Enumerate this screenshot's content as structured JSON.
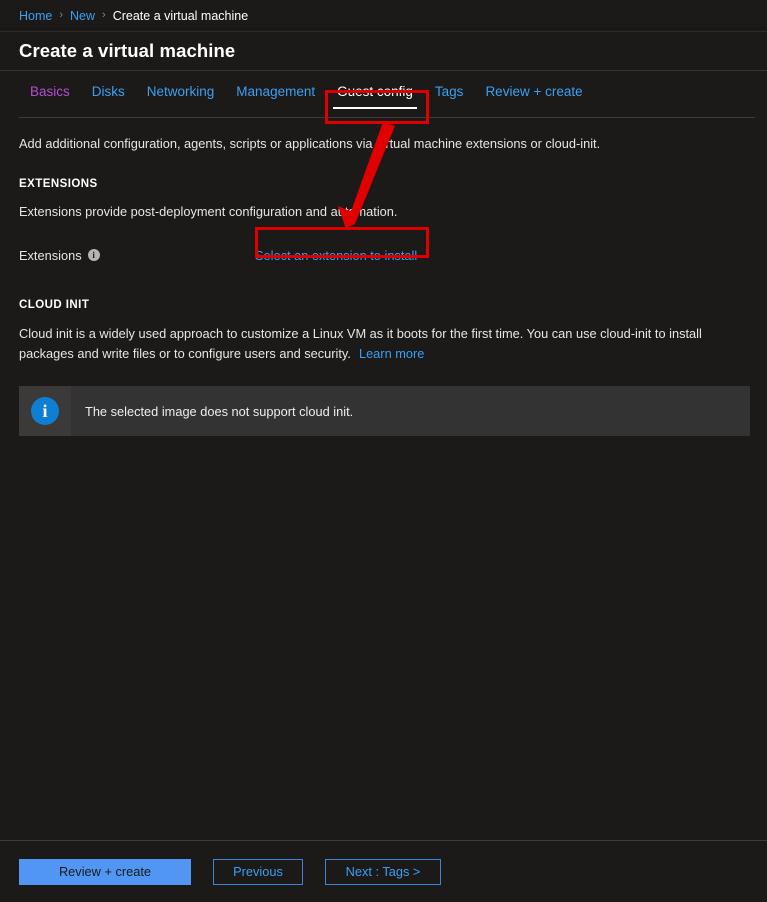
{
  "breadcrumb": {
    "items": [
      {
        "label": "Home",
        "type": "link"
      },
      {
        "label": "New",
        "type": "link"
      },
      {
        "label": "Create a virtual machine",
        "type": "current"
      }
    ],
    "separator": "›"
  },
  "header": {
    "title": "Create a virtual machine"
  },
  "tabs": [
    {
      "label": "Basics",
      "state": "visited"
    },
    {
      "label": "Disks",
      "state": "default"
    },
    {
      "label": "Networking",
      "state": "default"
    },
    {
      "label": "Management",
      "state": "default"
    },
    {
      "label": "Guest config",
      "state": "active"
    },
    {
      "label": "Tags",
      "state": "default"
    },
    {
      "label": "Review + create",
      "state": "default"
    }
  ],
  "main": {
    "lead": "Add additional configuration, agents, scripts or applications via virtual machine extensions or cloud-init.",
    "extensions": {
      "heading": "EXTENSIONS",
      "description": "Extensions provide post-deployment configuration and automation.",
      "field_label": "Extensions",
      "info_icon_glyph": "i",
      "select_link": "Select an extension to install"
    },
    "cloud_init": {
      "heading": "CLOUD INIT",
      "description": "Cloud init is a widely used approach to customize a Linux VM as it boots for the first time. You can use cloud-init to install packages and write files or to configure users and security.",
      "learn_more": "Learn more"
    },
    "banner": {
      "icon": "info-icon",
      "icon_glyph": "i",
      "message": "The selected image does not support cloud init."
    }
  },
  "footer": {
    "review_create": "Review + create",
    "previous": "Previous",
    "next": "Next : Tags >"
  },
  "annotations": {
    "highlight_color": "#e00000",
    "tab_box_target": "Guest config",
    "link_box_target": "Select an extension to install",
    "arrow": "points from Guest config tab down to Select an extension to install"
  },
  "colors": {
    "background": "#1b1a19",
    "link_blue": "#3aa0f3",
    "visited_purple": "#b14fd1",
    "primary_button": "#5196f2",
    "banner_bg": "#333333",
    "banner_icon_bg": "#0f7fd4",
    "annotation_red": "#e00000"
  }
}
